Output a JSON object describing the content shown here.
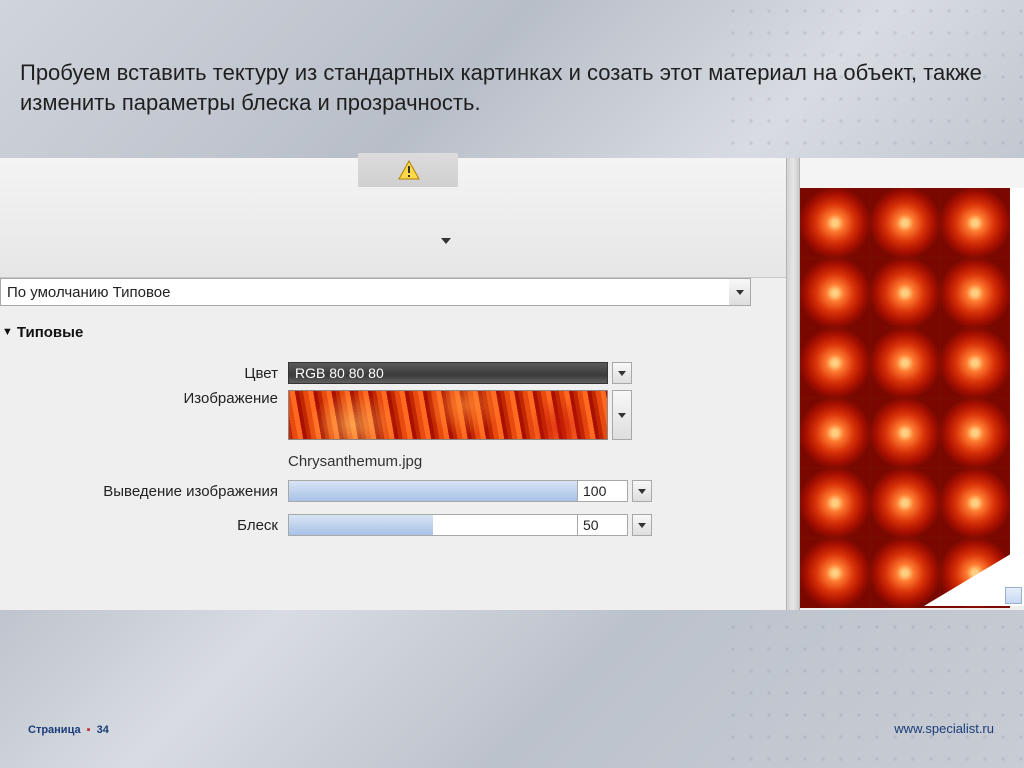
{
  "heading": "Пробуем вставить тектуру из стандартных картинках и созать этот материал на объект, также изменить параметры блеска и прозрачность.",
  "footer": {
    "page_word": "Страница",
    "page_num": "34",
    "url": "www.specialist.ru"
  },
  "panel": {
    "default_material": "По умолчанию Типовое",
    "section_title": "Типовые",
    "labels": {
      "color": "Цвет",
      "image": "Изображение",
      "image_fade": "Выведение изображения",
      "gloss": "Блеск"
    },
    "values": {
      "color": "RGB 80 80 80",
      "image_file": "Chrysanthemum.jpg",
      "image_fade": "100",
      "gloss": "50"
    },
    "slider_percent": {
      "image_fade": 100,
      "gloss": 50
    }
  }
}
